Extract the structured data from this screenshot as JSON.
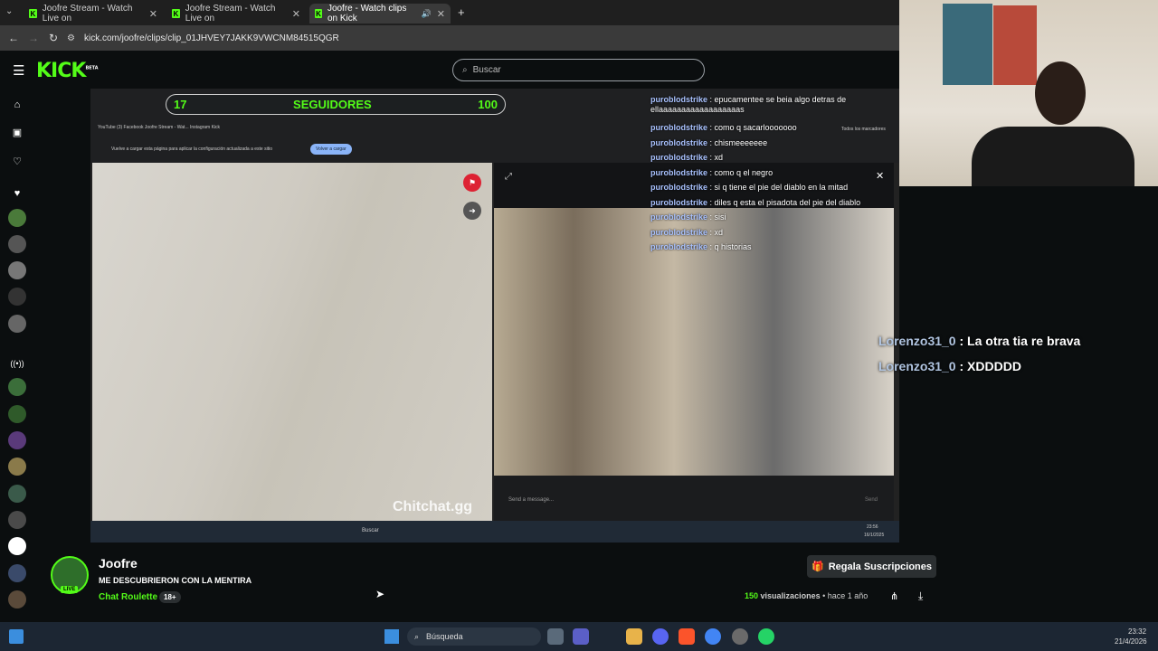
{
  "browser": {
    "tabs": [
      {
        "label": "Joofre Stream - Watch Live on",
        "active": false
      },
      {
        "label": "Joofre Stream - Watch Live on",
        "active": false
      },
      {
        "label": "Joofre - Watch clips on Kick",
        "active": true
      }
    ],
    "url": "kick.com/joofre/clips/clip_01JHVEY7JAKK9VWCNM84515QGR"
  },
  "header": {
    "logo": "KICK",
    "beta": "BETA",
    "search_placeholder": "Buscar"
  },
  "video": {
    "followers_current": "17",
    "followers_label": "SEGUIDORES",
    "followers_goal": "100",
    "watermark": "Chitchat.gg",
    "message_placeholder": "Send a message...",
    "send_label": "Send",
    "inner_bookmarks": "YouTube  (3) Facebook  Joofre Stream - Wat...  Instagram  Kick",
    "inner_notice": "Vuelve a cargar esta página para aplicar la configuración actualizada a este sitio",
    "inner_reload": "Volver a cargar",
    "inner_clock": "23:56",
    "inner_date": "16/1/2025",
    "inner_search": "Buscar",
    "inner_bookmarks_all": "Todos los marcadores"
  },
  "chat_overlay": [
    {
      "user": "puroblodstrike",
      "text": "epucamentee se beia algo detras de ellaaaaaaaaaaaaaaaaaas"
    },
    {
      "user": "puroblodstrike",
      "text": "como q sacarlooooooo"
    },
    {
      "user": "puroblodstrike",
      "text": "chismeeeeeee"
    },
    {
      "user": "puroblodstrike",
      "text": "xd"
    },
    {
      "user": "puroblodstrike",
      "text": "como q el negro"
    },
    {
      "user": "puroblodstrike",
      "text": "si q tiene el pie del diablo en la mitad"
    },
    {
      "user": "puroblodstrike",
      "text": "diles q esta el pisadota del pie del diablo"
    },
    {
      "user": "puroblodstrike",
      "text": "sisi"
    },
    {
      "user": "puroblodstrike",
      "text": "xd"
    },
    {
      "user": "puroblodstrike",
      "text": "q historias"
    }
  ],
  "stream_chat": [
    {
      "user": "Lorenzo31_0",
      "text": "La otra tia re brava"
    },
    {
      "user": "Lorenzo31_0",
      "text": "XDDDDD"
    }
  ],
  "clip": {
    "channel": "Joofre",
    "title": "ME DESCUBRIERON CON LA MENTIRA",
    "category": "Chat Roulette",
    "rating": "18+",
    "live_badge": "LIVE",
    "views": "150",
    "views_label": "visualizaciones",
    "age": "hace 1 año",
    "gift_button": "Regala Suscripciones"
  },
  "taskbar": {
    "search": "Búsqueda",
    "time": "23:32",
    "date": "21/4/2026"
  },
  "colors": {
    "brand": "#53fc18",
    "bg": "#0b0e0f",
    "chat_user": "#a9c2ff"
  }
}
